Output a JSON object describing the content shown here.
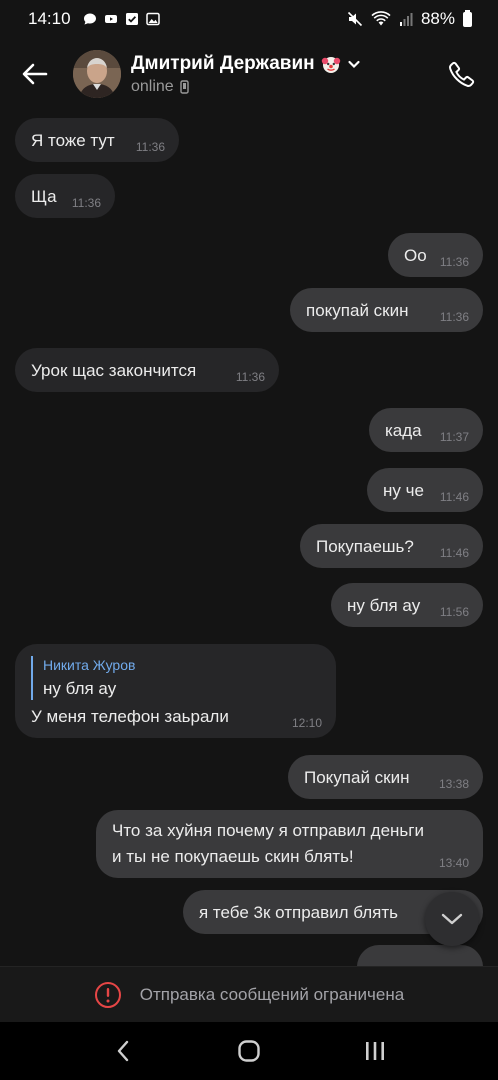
{
  "status_bar": {
    "time": "14:10",
    "battery": "88%"
  },
  "header": {
    "contact_name": "Дмитрий Державин",
    "status": "online"
  },
  "messages": [
    {
      "direction": "in",
      "text": "Я тоже тут",
      "time": "11:36"
    },
    {
      "direction": "in",
      "text": "Ща",
      "time": "11:36"
    },
    {
      "direction": "out",
      "text": "Оо",
      "time": "11:36"
    },
    {
      "direction": "out",
      "text": "покупай скин",
      "time": "11:36"
    },
    {
      "direction": "in",
      "text": "Урок щас закончится",
      "time": "11:36"
    },
    {
      "direction": "out",
      "text": "када",
      "time": "11:37"
    },
    {
      "direction": "out",
      "text": "ну че",
      "time": "11:46"
    },
    {
      "direction": "out",
      "text": "Покупаешь?",
      "time": "11:46"
    },
    {
      "direction": "out",
      "text": "ну бля ау",
      "time": "11:56"
    },
    {
      "direction": "in",
      "reply_to_name": "Никита Журов",
      "reply_to_text": "ну бля ау",
      "text": "У меня телефон заьрали",
      "time": "12:10"
    },
    {
      "direction": "out",
      "text": "Покупай скин",
      "time": "13:38"
    },
    {
      "direction": "out",
      "text_line1": "Что за хуйня почему я отправил деньги",
      "text_line2": "и ты не покупаешь скин блять!",
      "time": "13:40"
    },
    {
      "direction": "out",
      "text": "я тебе 3к отправил блять",
      "time": ""
    }
  ],
  "restriction": {
    "text": "Отправка сообщений ограничена"
  },
  "colors": {
    "background": "#141414",
    "bubble_in": "#262628",
    "bubble_out": "#3a3a3c",
    "accent": "#71aaeb",
    "warning": "#e64646"
  },
  "icons": [
    "back-arrow-icon",
    "chevron-down-icon",
    "phone-icon",
    "clown-emoji-icon",
    "mobile-device-icon",
    "chevron-down-scroll-icon",
    "error-circle-icon",
    "nav-back-icon",
    "nav-home-icon",
    "nav-recents-icon"
  ]
}
